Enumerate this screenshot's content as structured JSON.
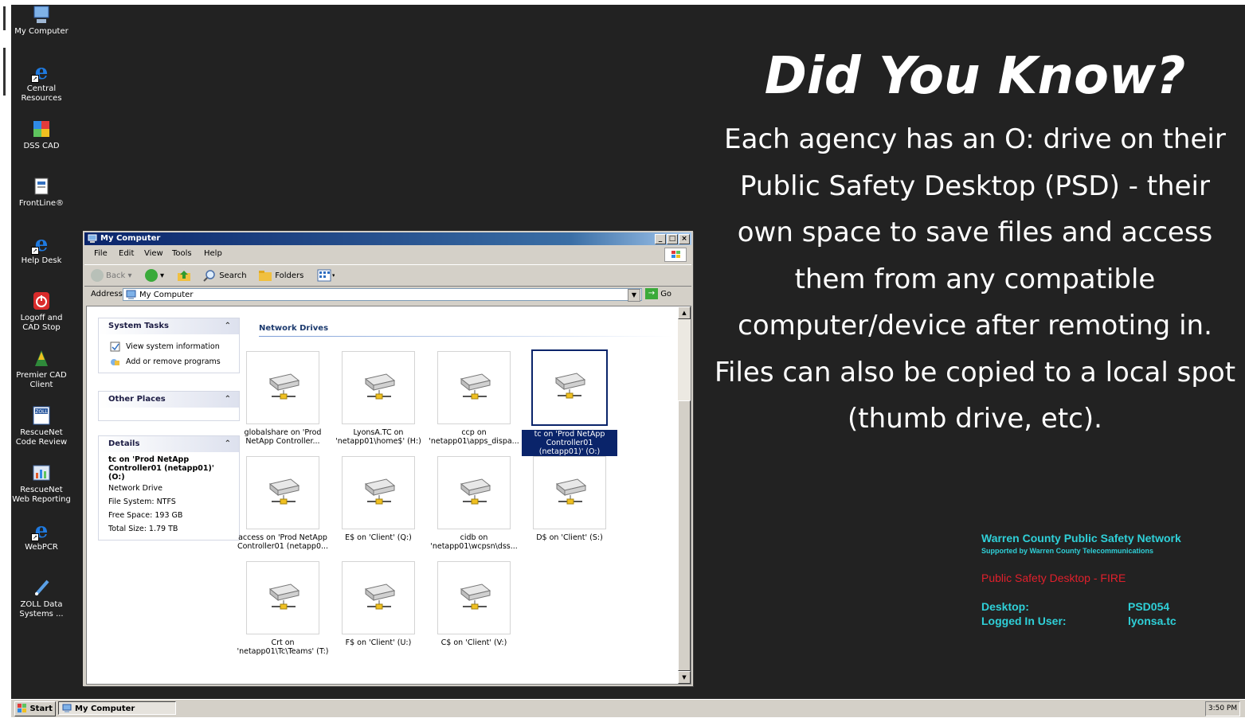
{
  "desktop_icons": [
    {
      "label": "My Computer"
    },
    {
      "label": "Central Resources"
    },
    {
      "label": "DSS CAD"
    },
    {
      "label": "FrontLine®"
    },
    {
      "label": "Help Desk"
    },
    {
      "label": "Logoff and CAD Stop"
    },
    {
      "label": "Premier CAD Client"
    },
    {
      "label": "RescueNet Code Review"
    },
    {
      "label": "RescueNet Web Reporting"
    },
    {
      "label": "WebPCR"
    },
    {
      "label": "ZOLL Data Systems ..."
    }
  ],
  "slide": {
    "title": "Did You Know?",
    "body": "Each agency has an O: drive on their Public Safety Desktop (PSD) - their own space to save files and access them from any compatible computer/device after remoting in. Files can also be copied to a local spot (thumb drive, etc)."
  },
  "bginfo": {
    "network_title": "Warren County Public Safety Network",
    "network_sub": "Supported by Warren County Telecommunications",
    "psd_line": "Public Safety Desktop - FIRE",
    "desktop_label": "Desktop:",
    "desktop_value": "PSD054",
    "user_label": "Logged In User:",
    "user_value": "lyonsa.tc"
  },
  "window": {
    "title": "My Computer",
    "menu": [
      "File",
      "Edit",
      "View",
      "Tools",
      "Help"
    ],
    "toolbar": {
      "back": "Back",
      "search": "Search",
      "folders": "Folders"
    },
    "address_label": "Address",
    "address_value": "My Computer",
    "go_label": "Go",
    "system_tasks": {
      "title": "System Tasks",
      "items": [
        "View system information",
        "Add or remove programs"
      ]
    },
    "other_places": {
      "title": "Other Places"
    },
    "details": {
      "title": "Details",
      "name": "tc on 'Prod NetApp Controller01 (netapp01)' (O:)",
      "type": "Network Drive",
      "filesystem": "File System: NTFS",
      "free": "Free Space: 193 GB",
      "total": "Total Size: 1.79 TB"
    },
    "section_label": "Network Drives",
    "drives": [
      {
        "label": "globalshare on 'Prod NetApp Controller..."
      },
      {
        "label": "LyonsA.TC on 'netapp01\\home$' (H:)"
      },
      {
        "label": "ccp on 'netapp01\\apps_dispa..."
      },
      {
        "label": "tc on 'Prod NetApp Controller01 (netapp01)' (O:)",
        "selected": true
      },
      {
        "label": "access on 'Prod NetApp Controller01 (netapp0..."
      },
      {
        "label": "E$ on 'Client' (Q:)"
      },
      {
        "label": "cidb on 'netapp01\\wcpsn\\dss..."
      },
      {
        "label": "D$ on 'Client' (S:)"
      },
      {
        "label": "Crt on 'netapp01\\Tc\\Teams' (T:)"
      },
      {
        "label": "F$ on 'Client' (U:)"
      },
      {
        "label": "C$ on 'Client' (V:)"
      }
    ]
  },
  "taskbar": {
    "start": "Start",
    "task": "My Computer",
    "clock": "3:50 PM"
  }
}
